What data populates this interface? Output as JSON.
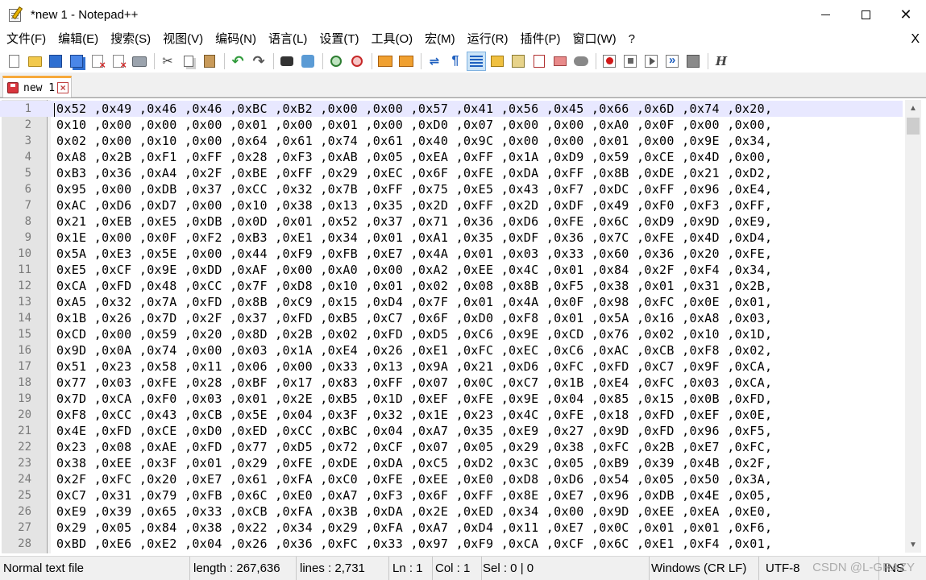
{
  "window": {
    "title": "*new 1 - Notepad++",
    "minimize_glyph": "minimize",
    "maximize_glyph": "maximize",
    "close_glyph": "✕"
  },
  "menu": {
    "items": [
      "文件(F)",
      "编辑(E)",
      "搜索(S)",
      "视图(V)",
      "编码(N)",
      "语言(L)",
      "设置(T)",
      "工具(O)",
      "宏(M)",
      "运行(R)",
      "插件(P)",
      "窗口(W)",
      "?"
    ],
    "close_label": "X"
  },
  "toolbar": {
    "icons": [
      "new-file",
      "open-file",
      "save",
      "save-all",
      "close",
      "close-all",
      "print",
      "cut",
      "copy",
      "paste",
      "undo",
      "redo",
      "find",
      "replace",
      "zoom-in",
      "zoom-out",
      "sync-vertical",
      "sync-horizontal",
      "word-wrap",
      "show-all-characters",
      "indent-guide",
      "user-defined-language",
      "document-map",
      "function-list",
      "folder-as-workspace",
      "monitoring",
      "start-recording",
      "stop-recording",
      "playback",
      "run-macro-multiple",
      "save-macro",
      "hex"
    ],
    "hex_label": "H"
  },
  "tabs": [
    {
      "label": "new 1",
      "close_label": "×"
    }
  ],
  "editor": {
    "current_line": 1,
    "lines": [
      "0x52 ,0x49 ,0x46 ,0x46 ,0xBC ,0xB2 ,0x00 ,0x00 ,0x57 ,0x41 ,0x56 ,0x45 ,0x66 ,0x6D ,0x74 ,0x20,",
      "0x10 ,0x00 ,0x00 ,0x00 ,0x01 ,0x00 ,0x01 ,0x00 ,0xD0 ,0x07 ,0x00 ,0x00 ,0xA0 ,0x0F ,0x00 ,0x00,",
      "0x02 ,0x00 ,0x10 ,0x00 ,0x64 ,0x61 ,0x74 ,0x61 ,0x40 ,0x9C ,0x00 ,0x00 ,0x01 ,0x00 ,0x9E ,0x34,",
      "0xA8 ,0x2B ,0xF1 ,0xFF ,0x28 ,0xF3 ,0xAB ,0x05 ,0xEA ,0xFF ,0x1A ,0xD9 ,0x59 ,0xCE ,0x4D ,0x00,",
      "0xB3 ,0x36 ,0xA4 ,0x2F ,0xBE ,0xFF ,0x29 ,0xEC ,0x6F ,0xFE ,0xDA ,0xFF ,0x8B ,0xDE ,0x21 ,0xD2,",
      "0x95 ,0x00 ,0xDB ,0x37 ,0xCC ,0x32 ,0x7B ,0xFF ,0x75 ,0xE5 ,0x43 ,0xF7 ,0xDC ,0xFF ,0x96 ,0xE4,",
      "0xAC ,0xD6 ,0xD7 ,0x00 ,0x10 ,0x38 ,0x13 ,0x35 ,0x2D ,0xFF ,0x2D ,0xDF ,0x49 ,0xF0 ,0xF3 ,0xFF,",
      "0x21 ,0xEB ,0xE5 ,0xDB ,0x0D ,0x01 ,0x52 ,0x37 ,0x71 ,0x36 ,0xD6 ,0xFE ,0x6C ,0xD9 ,0x9D ,0xE9,",
      "0x1E ,0x00 ,0x0F ,0xF2 ,0xB3 ,0xE1 ,0x34 ,0x01 ,0xA1 ,0x35 ,0xDF ,0x36 ,0x7C ,0xFE ,0x4D ,0xD4,",
      "0x5A ,0xE3 ,0x5E ,0x00 ,0x44 ,0xF9 ,0xFB ,0xE7 ,0x4A ,0x01 ,0x03 ,0x33 ,0x60 ,0x36 ,0x20 ,0xFE,",
      "0xE5 ,0xCF ,0x9E ,0xDD ,0xAF ,0x00 ,0xA0 ,0x00 ,0xA2 ,0xEE ,0x4C ,0x01 ,0x84 ,0x2F ,0xF4 ,0x34,",
      "0xCA ,0xFD ,0x48 ,0xCC ,0x7F ,0xD8 ,0x10 ,0x01 ,0x02 ,0x08 ,0x8B ,0xF5 ,0x38 ,0x01 ,0x31 ,0x2B,",
      "0xA5 ,0x32 ,0x7A ,0xFD ,0x8B ,0xC9 ,0x15 ,0xD4 ,0x7F ,0x01 ,0x4A ,0x0F ,0x98 ,0xFC ,0x0E ,0x01,",
      "0x1B ,0x26 ,0x7D ,0x2F ,0x37 ,0xFD ,0xB5 ,0xC7 ,0x6F ,0xD0 ,0xF8 ,0x01 ,0x5A ,0x16 ,0xA8 ,0x03,",
      "0xCD ,0x00 ,0x59 ,0x20 ,0x8D ,0x2B ,0x02 ,0xFD ,0xD5 ,0xC6 ,0x9E ,0xCD ,0x76 ,0x02 ,0x10 ,0x1D,",
      "0x9D ,0x0A ,0x74 ,0x00 ,0x03 ,0x1A ,0xE4 ,0x26 ,0xE1 ,0xFC ,0xEC ,0xC6 ,0xAC ,0xCB ,0xF8 ,0x02,",
      "0x51 ,0x23 ,0x58 ,0x11 ,0x06 ,0x00 ,0x33 ,0x13 ,0x9A ,0x21 ,0xD6 ,0xFC ,0xFD ,0xC7 ,0x9F ,0xCA,",
      "0x77 ,0x03 ,0xFE ,0x28 ,0xBF ,0x17 ,0x83 ,0xFF ,0x07 ,0x0C ,0xC7 ,0x1B ,0xE4 ,0xFC ,0x03 ,0xCA,",
      "0x7D ,0xCA ,0xF0 ,0x03 ,0x01 ,0x2E ,0xB5 ,0x1D ,0xEF ,0xFE ,0x9E ,0x04 ,0x85 ,0x15 ,0x0B ,0xFD,",
      "0xF8 ,0xCC ,0x43 ,0xCB ,0x5E ,0x04 ,0x3F ,0x32 ,0x1E ,0x23 ,0x4C ,0xFE ,0x18 ,0xFD ,0xEF ,0x0E,",
      "0x4E ,0xFD ,0xCE ,0xD0 ,0xED ,0xCC ,0xBC ,0x04 ,0xA7 ,0x35 ,0xE9 ,0x27 ,0x9D ,0xFD ,0x96 ,0xF5,",
      "0x23 ,0x08 ,0xAE ,0xFD ,0x77 ,0xD5 ,0x72 ,0xCF ,0x07 ,0x05 ,0x29 ,0x38 ,0xFC ,0x2B ,0xE7 ,0xFC,",
      "0x38 ,0xEE ,0x3F ,0x01 ,0x29 ,0xFE ,0xDE ,0xDA ,0xC5 ,0xD2 ,0x3C ,0x05 ,0xB9 ,0x39 ,0x4B ,0x2F,",
      "0x2F ,0xFC ,0x20 ,0xE7 ,0x61 ,0xFA ,0xC0 ,0xFE ,0xEE ,0xE0 ,0xD8 ,0xD6 ,0x54 ,0x05 ,0x50 ,0x3A,",
      "0xC7 ,0x31 ,0x79 ,0xFB ,0x6C ,0xE0 ,0xA7 ,0xF3 ,0x6F ,0xFF ,0x8E ,0xE7 ,0x96 ,0xDB ,0x4E ,0x05,",
      "0xE9 ,0x39 ,0x65 ,0x33 ,0xCB ,0xFA ,0x3B ,0xDA ,0x2E ,0xED ,0x34 ,0x00 ,0x9D ,0xEE ,0xEA ,0xE0,",
      "0x29 ,0x05 ,0x84 ,0x38 ,0x22 ,0x34 ,0x29 ,0xFA ,0xA7 ,0xD4 ,0x11 ,0xE7 ,0x0C ,0x01 ,0x01 ,0xF6,",
      "0xBD ,0xE6 ,0xE2 ,0x04 ,0x26 ,0x36 ,0xFC ,0x33 ,0x97 ,0xF9 ,0xCA ,0xCF ,0x6C ,0xE1 ,0xF4 ,0x01,"
    ]
  },
  "status": {
    "file_type": "Normal text file",
    "length": "length : 267,636",
    "lines": "lines : 2,731",
    "ln": "Ln : 1",
    "col": "Col : 1",
    "sel": "Sel : 0 | 0",
    "eol": "Windows (CR LF)",
    "encoding": "UTF-8",
    "mode": "INS"
  },
  "watermark": "CSDN @L-GRAZY"
}
